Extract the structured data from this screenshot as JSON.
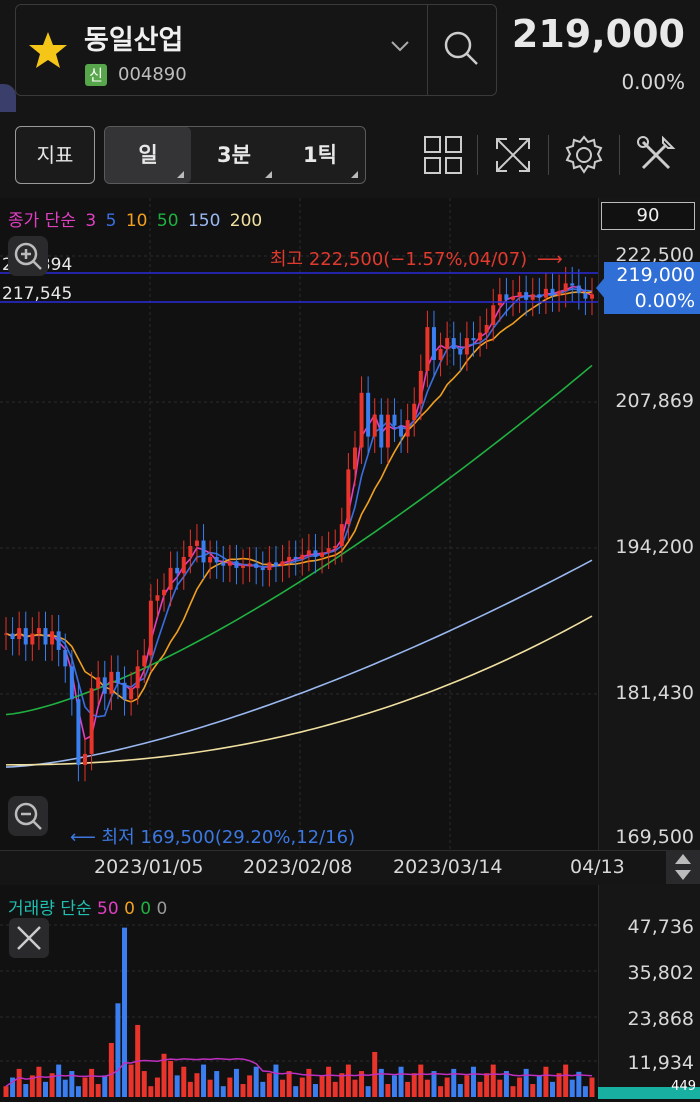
{
  "header": {
    "stock_name": "동일산업",
    "badge": "신",
    "code": "004890",
    "price": "219,000",
    "change_pct": "0.00%"
  },
  "toolbar": {
    "indicator_label": "지표",
    "periods": [
      "일",
      "3분",
      "1틱"
    ],
    "active_period": "일"
  },
  "chart": {
    "ma_legend": {
      "prefix": "종가 단순",
      "periods": [
        "3",
        "5",
        "10",
        "50",
        "150",
        "200"
      ],
      "colors": [
        "#e040c0",
        "#3a6ee0",
        "#f0a020",
        "#20b040",
        "#9ab8f0",
        "#f0e0a0"
      ]
    },
    "visible_count": "90",
    "y_labels": [
      "222,500",
      "207,869",
      "194,200",
      "181,430",
      "169,500"
    ],
    "current_price": "219,000",
    "current_pct": "0.00%",
    "hline_upper": "220,394",
    "hline_lower": "217,545",
    "max_annotation": "최고 222,500(−1.57%,04/07)",
    "min_annotation": "최저 169,500(29.20%,12/16)",
    "x_labels": [
      "2023/01/05",
      "2023/02/08",
      "2023/03/14",
      "04/13"
    ]
  },
  "volume": {
    "legend_prefix": "거래량 단순",
    "legend_values": [
      "50",
      "0",
      "0",
      "0"
    ],
    "legend_colors": [
      "#e040c0",
      "#f0a020",
      "#20b040",
      "#9a9a9a"
    ],
    "y_labels": [
      "47,736",
      "35,802",
      "23,868",
      "11,934"
    ],
    "bottom_badge": "449"
  },
  "chart_data": {
    "type": "candlestick",
    "y_range": [
      169500,
      222500
    ],
    "closes": [
      188000,
      187500,
      188500,
      187000,
      188000,
      188500,
      187000,
      188200,
      186500,
      185000,
      182000,
      176000,
      177000,
      183000,
      184000,
      182500,
      184500,
      183500,
      182000,
      183000,
      185000,
      186000,
      191000,
      191500,
      192000,
      194000,
      193500,
      195000,
      196000,
      196500,
      194500,
      195000,
      194500,
      194200,
      194600,
      194000,
      194200,
      194400,
      194000,
      193800,
      194500,
      194200,
      194600,
      195000,
      194800,
      195200,
      195600,
      195000,
      195400,
      195800,
      196000,
      198000,
      203000,
      205000,
      210000,
      206000,
      208000,
      205000,
      208000,
      207000,
      206000,
      207500,
      209000,
      212000,
      216000,
      213000,
      214000,
      215000,
      214000,
      213500,
      215000,
      214800,
      215500,
      216200,
      218000,
      219000,
      218500,
      218800,
      219200,
      218500,
      219000,
      218700,
      219500,
      218900,
      219300,
      220000,
      219800,
      219100,
      218600,
      219000
    ]
  }
}
